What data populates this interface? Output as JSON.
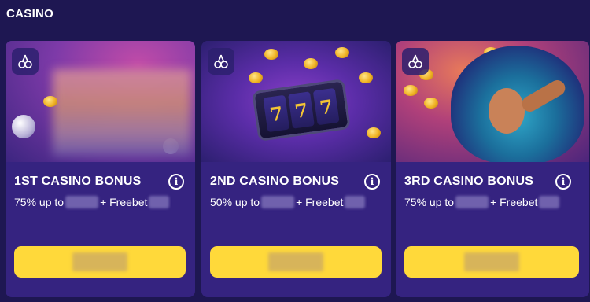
{
  "section": {
    "title": "CASINO"
  },
  "cards": [
    {
      "title": "1ST CASINO BONUS",
      "percent_text": "75% up to",
      "freebet_text": "+ Freebet",
      "badge_icon": "cherries-icon",
      "info_icon": "info-icon"
    },
    {
      "title": "2ND CASINO BONUS",
      "percent_text": "50% up to",
      "freebet_text": "+ Freebet",
      "badge_icon": "cherries-icon",
      "info_icon": "info-icon"
    },
    {
      "title": "3RD CASINO BONUS",
      "percent_text": "75% up to",
      "freebet_text": "+ Freebet",
      "badge_icon": "cherries-icon",
      "info_icon": "info-icon"
    }
  ],
  "slot_reels": [
    "7",
    "7",
    "7"
  ],
  "colors": {
    "page_bg": "#1e1752",
    "card_bg": "#352380",
    "cta": "#ffd93a"
  }
}
